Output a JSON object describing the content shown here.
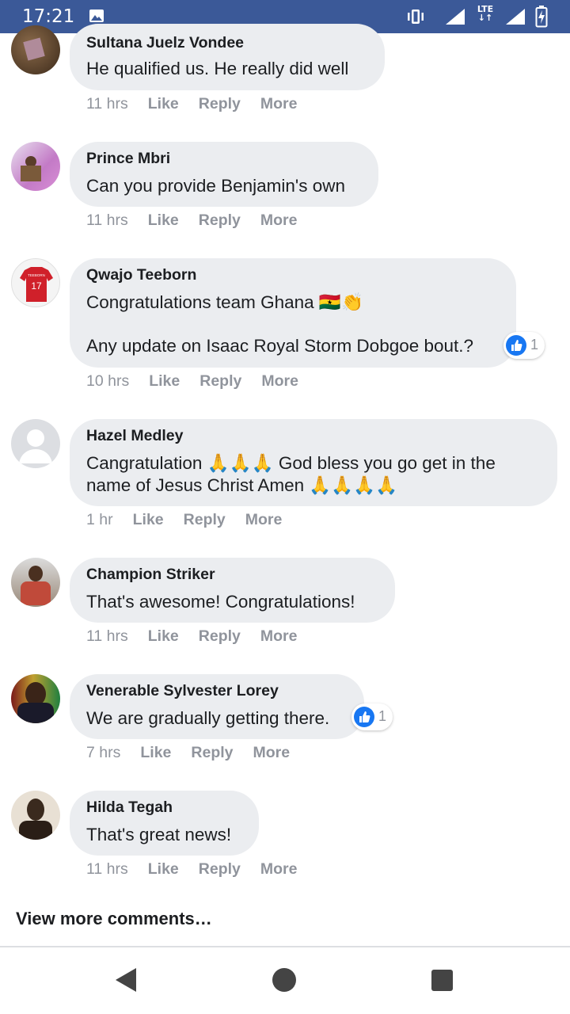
{
  "status_bar": {
    "time": "17:21",
    "network": "LTE",
    "icons": [
      "image-icon",
      "vibrate-icon",
      "signal-icon",
      "lte-icon",
      "signal-icon",
      "battery-charging-icon"
    ]
  },
  "comments": [
    {
      "author": "Sultana Juelz Vondee",
      "lines": [
        "He qualified us. He really did well"
      ],
      "time": "11 hrs",
      "like": "Like",
      "reply": "Reply",
      "more": "More"
    },
    {
      "author": "Prince Mbri",
      "lines": [
        "Can you provide Benjamin's own"
      ],
      "time": "11 hrs",
      "like": "Like",
      "reply": "Reply",
      "more": "More"
    },
    {
      "author": "Qwajo Teeborn",
      "lines": [
        "Congratulations team Ghana 🇬🇭👏",
        "",
        "Any update on Isaac Royal Storm Dobgoe bout.?"
      ],
      "time": "10 hrs",
      "like": "Like",
      "reply": "Reply",
      "more": "More",
      "reactions": "1",
      "jersey_text": "TEEBORN",
      "jersey_number": "17"
    },
    {
      "author": "Hazel Medley",
      "lines": [
        "Cangratulation 🙏🙏🙏 God bless you go get in the",
        "name of Jesus Christ Amen 🙏🙏🙏🙏"
      ],
      "time": "1 hr",
      "like": "Like",
      "reply": "Reply",
      "more": "More"
    },
    {
      "author": "Champion Striker",
      "lines": [
        "That's awesome! Congratulations!"
      ],
      "time": "11 hrs",
      "like": "Like",
      "reply": "Reply",
      "more": "More"
    },
    {
      "author": "Venerable Sylvester Lorey",
      "lines": [
        "We are gradually getting there."
      ],
      "time": "7 hrs",
      "like": "Like",
      "reply": "Reply",
      "more": "More",
      "reactions": "1"
    },
    {
      "author": "Hilda Tegah",
      "lines": [
        "That's great news!"
      ],
      "time": "11 hrs",
      "like": "Like",
      "reply": "Reply",
      "more": "More"
    }
  ],
  "view_more": "View more comments…",
  "colors": {
    "status_bar": "#3b5998",
    "bubble": "#ebedf0",
    "meta_text": "#90949c",
    "like_blue": "#1877f2"
  }
}
